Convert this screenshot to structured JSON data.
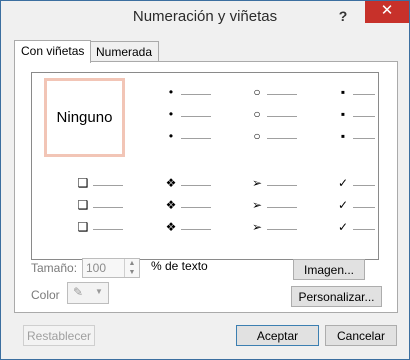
{
  "window": {
    "title": "Numeración y viñetas",
    "help_glyph": "?",
    "close_glyph": "✕"
  },
  "tabs": [
    {
      "label": "Con viñetas",
      "active": true
    },
    {
      "label": "Numerada",
      "active": false
    }
  ],
  "gallery": {
    "none_label": "Ninguno",
    "columns": [
      {
        "icon": "small-dot-bullet",
        "symbol": "•"
      },
      {
        "icon": "hollow-circle-bullet",
        "symbol": "○"
      },
      {
        "icon": "square-bullet",
        "symbol": "▪"
      },
      {
        "icon": "hollow-square-bullet",
        "symbol": "❑"
      },
      {
        "icon": "diamond-cluster-bullet",
        "symbol": "❖"
      },
      {
        "icon": "arrowhead-bullet",
        "symbol": "➢"
      },
      {
        "icon": "checkmark-bullet",
        "symbol": "✓"
      }
    ]
  },
  "size": {
    "label": "Tamaño:",
    "value": "100",
    "suffix": "% de texto"
  },
  "color": {
    "label": "Color"
  },
  "buttons": {
    "picture": "Imagen...",
    "customize": "Personalizar...",
    "reset": "Restablecer",
    "accept": "Aceptar",
    "cancel": "Cancelar"
  },
  "colors": {
    "close": "#c7312a",
    "selection": "#f2c5b6",
    "accent": "#3c7fb1"
  }
}
